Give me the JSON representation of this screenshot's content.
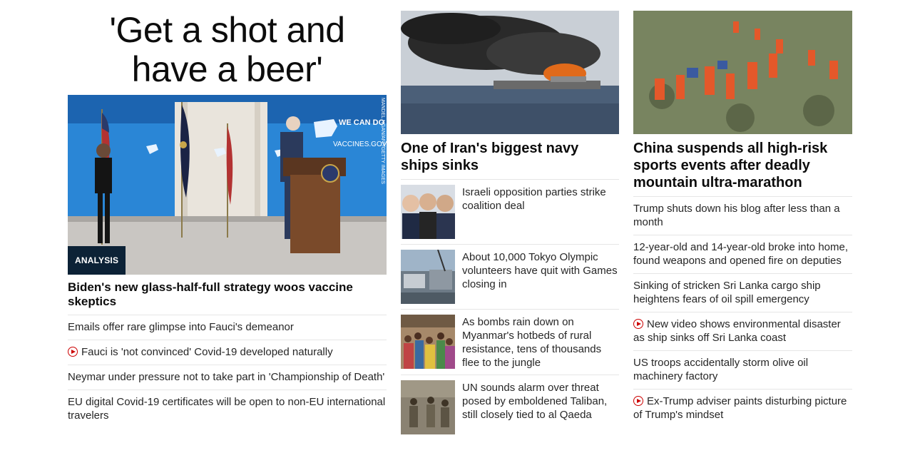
{
  "col1": {
    "big_headline": "'Get a shot and have a beer'",
    "hero_badge": "ANALYSIS",
    "hero_photo_credit": "MANDEL NGAN/AFP/GETTY IMAGES",
    "hero_banner_text": "WE CAN DO THIS",
    "hero_banner_url": "VACCINES.GOV",
    "lead_title": "Biden's new glass-half-full strategy woos vaccine skeptics",
    "links": [
      {
        "text": "Emails offer rare glimpse into Fauci's demeanor",
        "video": false
      },
      {
        "text": "Fauci is 'not convinced' Covid-19 developed naturally",
        "video": true
      },
      {
        "text": "Neymar under pressure not to take part in 'Championship of Death'",
        "video": false
      },
      {
        "text": "EU digital Covid-19 certificates will be open to non-EU international travelers",
        "video": false
      }
    ]
  },
  "col2": {
    "headline": "One of Iran's biggest navy ships sinks",
    "items": [
      {
        "text": "Israeli opposition parties strike coalition deal",
        "thumb": "politicians-photo"
      },
      {
        "text": "About 10,000 Tokyo Olympic volunteers have quit with Games closing in",
        "thumb": "stadium-construction-photo"
      },
      {
        "text": "As bombs rain down on Myanmar's hotbeds of rural resistance, tens of thousands flee to the jungle",
        "thumb": "crowd-photo"
      },
      {
        "text": "UN sounds alarm over threat posed by emboldened Taliban, still closely tied to al Qaeda",
        "thumb": "soldiers-photo"
      }
    ]
  },
  "col3": {
    "headline": "China suspends all high-risk sports events after deadly mountain ultra-marathon",
    "links": [
      {
        "text": "Trump shuts down his blog after less than a month",
        "video": false
      },
      {
        "text": "12-year-old and 14-year-old broke into home, found weapons and opened fire on deputies",
        "video": false
      },
      {
        "text": "Sinking of stricken Sri Lanka cargo ship heightens fears of oil spill emergency",
        "video": false
      },
      {
        "text": "New video shows environmental disaster as ship sinks off Sri Lanka coast",
        "video": true
      },
      {
        "text": "US troops accidentally storm olive oil machinery factory",
        "video": false
      },
      {
        "text": "Ex-Trump adviser paints disturbing picture of Trump's mindset",
        "video": true
      }
    ]
  },
  "colors": {
    "video_red": "#cc0000",
    "badge_bg": "#0c2236",
    "divider": "#e6e6e6",
    "text": "#0c0c0c"
  }
}
